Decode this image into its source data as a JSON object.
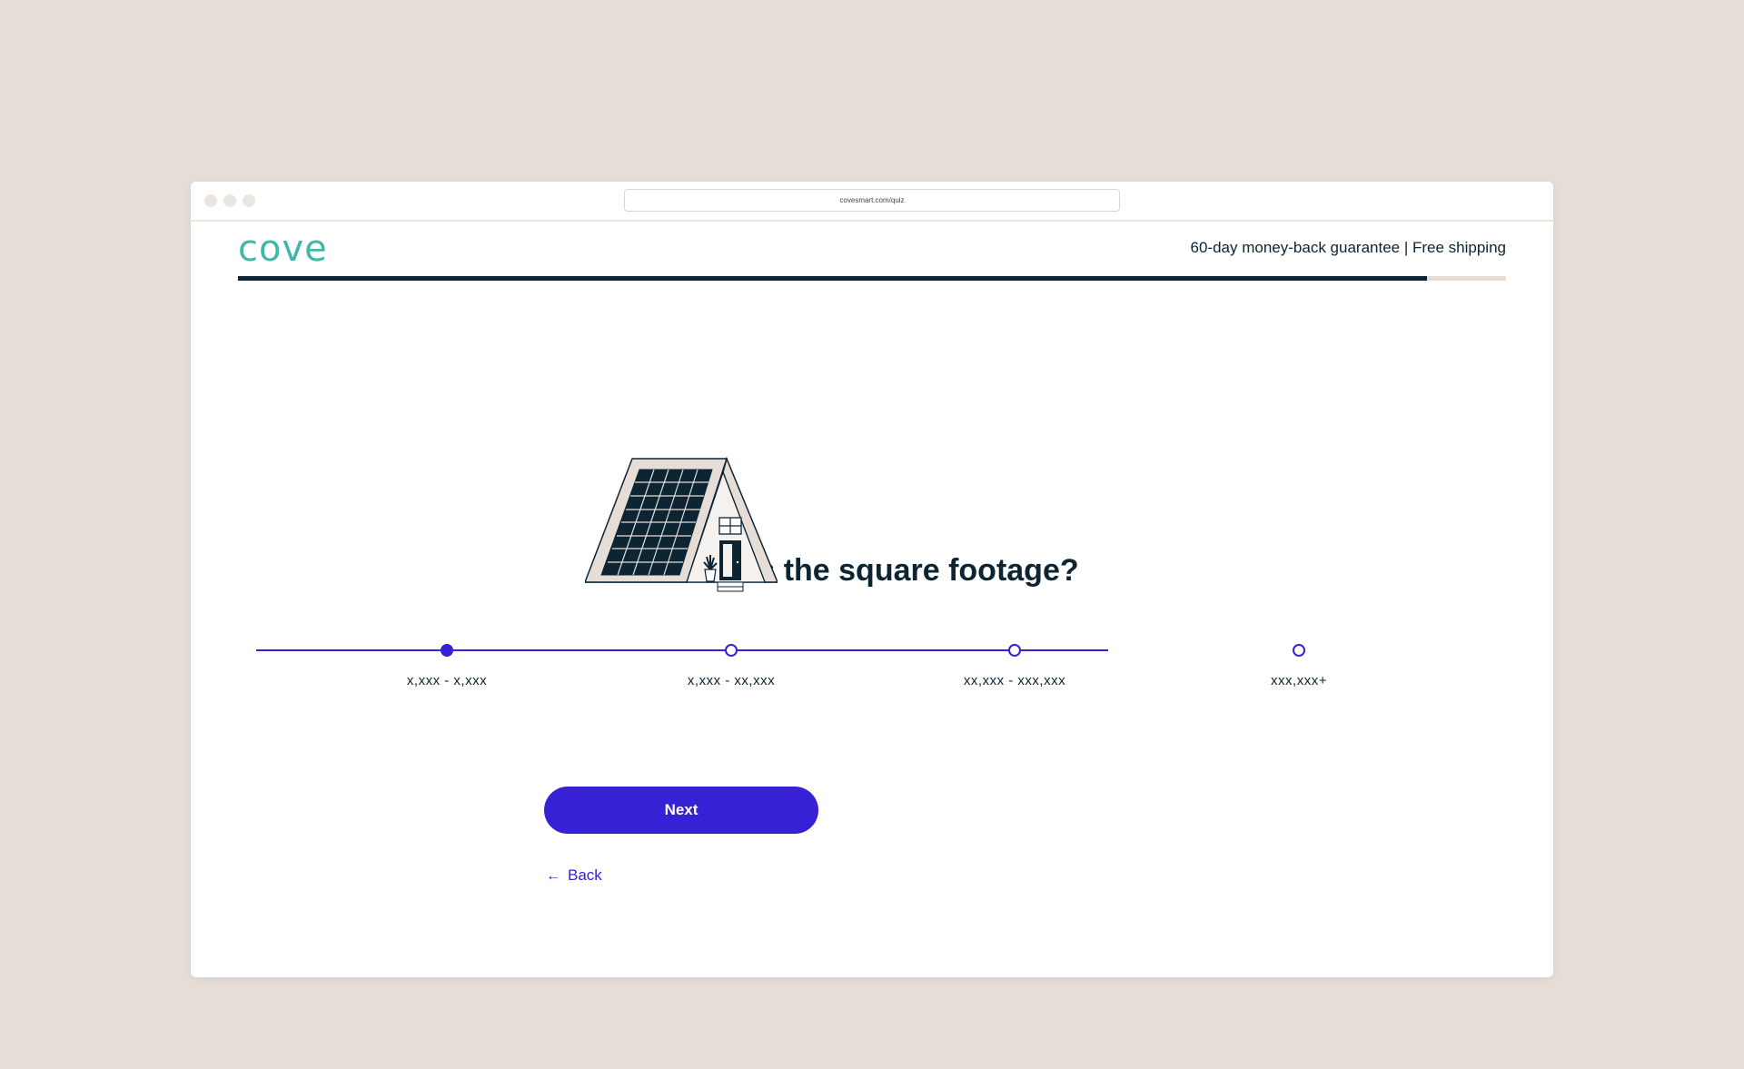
{
  "browser": {
    "url": "covesmart.com/quiz"
  },
  "header": {
    "logo_text": "cove",
    "guarantee_text": "60-day money-back guarantee | Free shipping"
  },
  "progress": {
    "fraction": 0.9375
  },
  "question": {
    "title": "What is the square footage?"
  },
  "slider": {
    "options": [
      "x,xxx - x,xxx",
      "x,xxx - xx,xxx",
      "xx,xxx - xxx,xxx",
      "xxx,xxx+"
    ],
    "selected_index": 0
  },
  "actions": {
    "next_label": "Next",
    "back_label": "Back",
    "back_icon": "arrow-left-icon"
  },
  "colors": {
    "brand_teal": "#3fb8a9",
    "accent": "#3721d4",
    "navy": "#0d2433",
    "background": "#e6ddd7"
  }
}
